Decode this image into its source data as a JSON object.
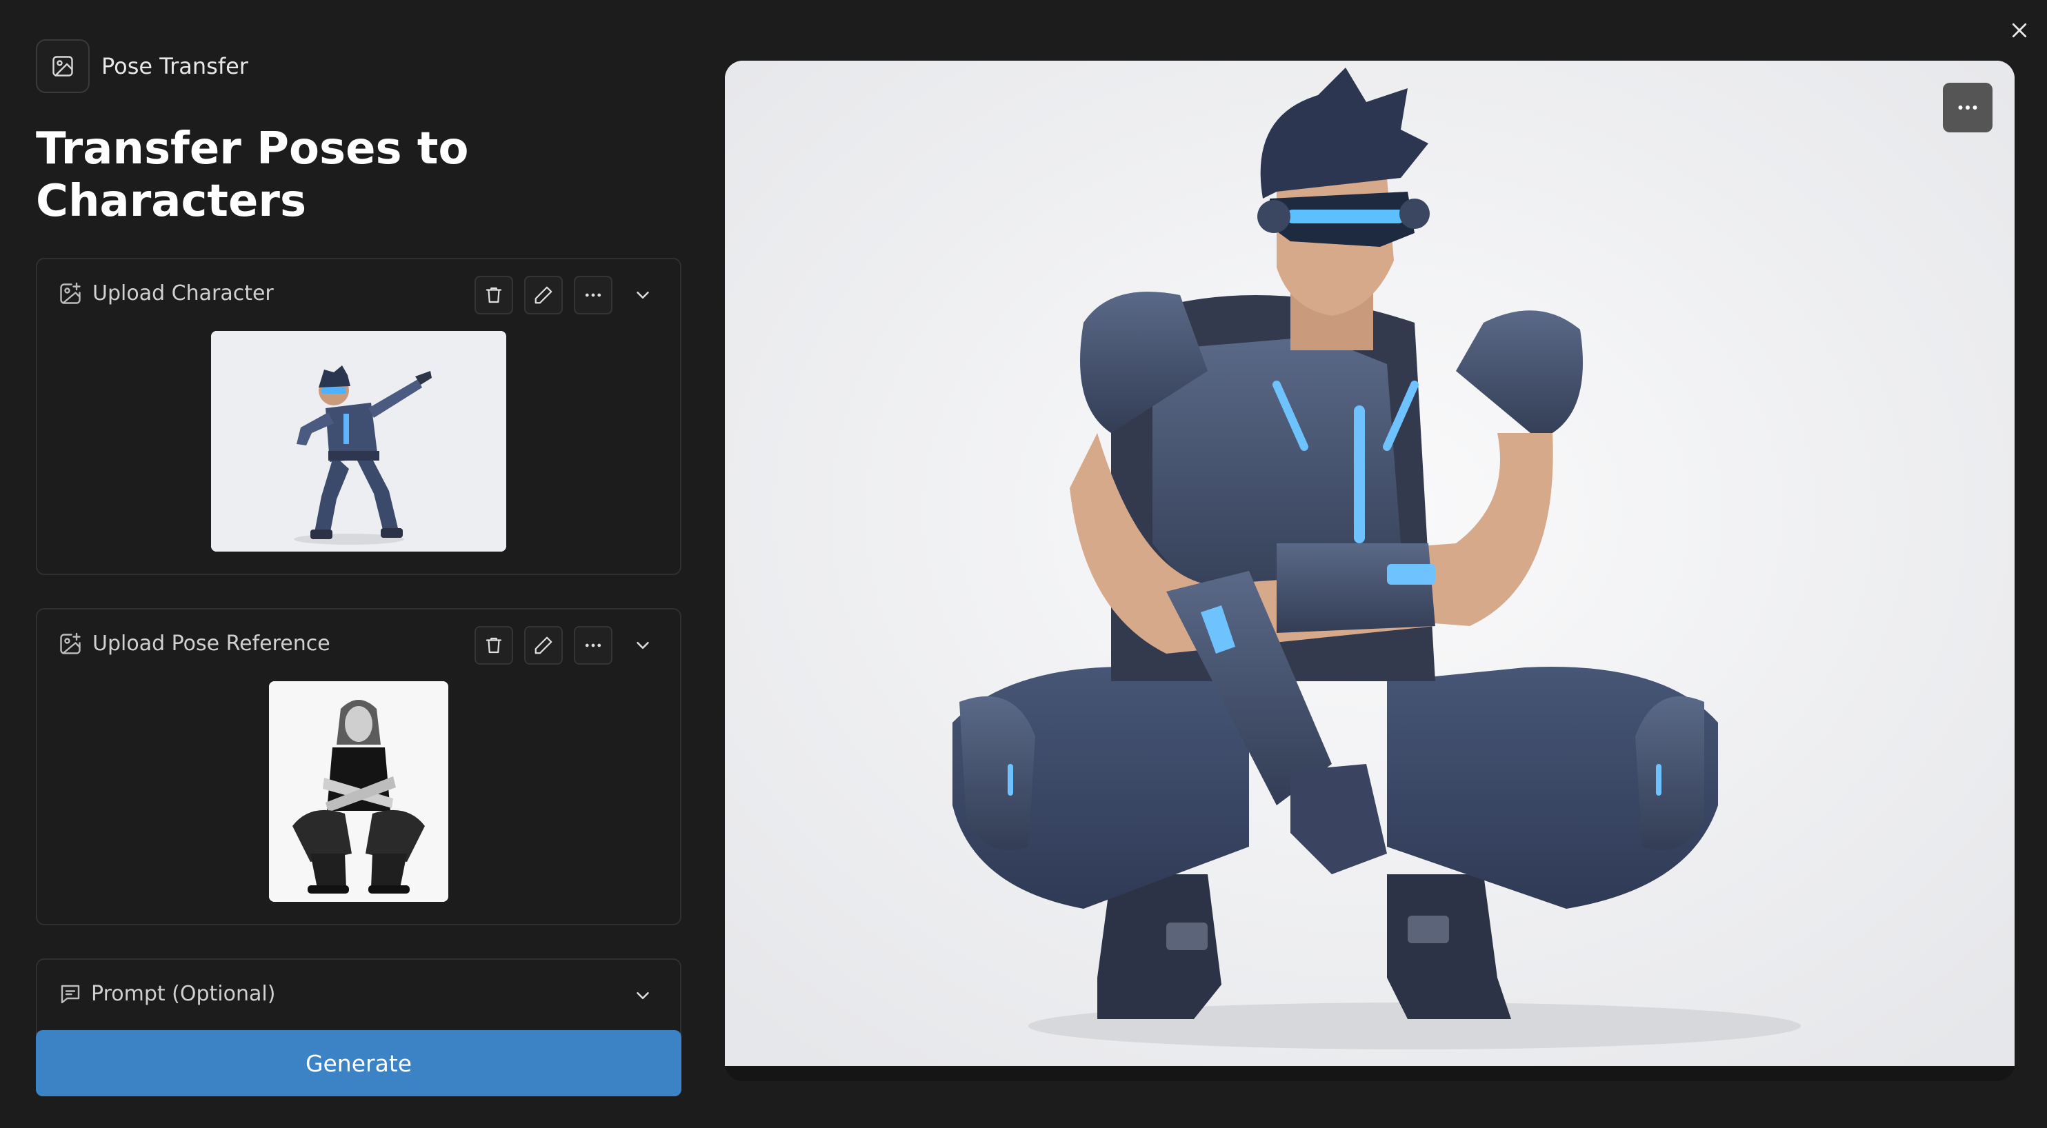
{
  "app": {
    "title": "Pose Transfer",
    "icon": "image-icon"
  },
  "page_title": "Transfer Poses to Characters",
  "cards": {
    "character": {
      "label": "Upload Character",
      "icon": "image-add-icon",
      "image_alt": "3D armored hero character doing a dab pose"
    },
    "pose": {
      "label": "Upload Pose Reference",
      "icon": "image-add-icon",
      "image_alt": "Black and white photo of a long-haired man squatting"
    },
    "prompt": {
      "label": "Prompt (Optional)",
      "icon": "message-icon"
    }
  },
  "actions": [
    "trash-icon",
    "pencil-icon",
    "more-icon",
    "chevron-down-icon"
  ],
  "generate_label": "Generate",
  "preview": {
    "image_alt": "Generated result: 3D armored hero character squatting with arms crossed"
  },
  "colors": {
    "background": "#1c1c1c",
    "accent": "#3c83c6",
    "card_border": "#303030"
  }
}
